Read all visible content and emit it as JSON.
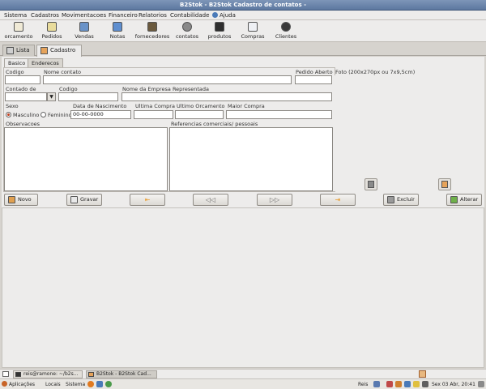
{
  "window": {
    "title": "B2Stok - B2Stok Cadastro de contatos -"
  },
  "menu": [
    "Sistema",
    "Cadastros",
    "Movimentacoes",
    "Financeiro",
    "Relatorios",
    "Contabilidade",
    "Ajuda"
  ],
  "toolbar": {
    "items": [
      {
        "label": "orcamento",
        "icon": "document-icon"
      },
      {
        "label": "Pedidos",
        "icon": "order-icon"
      },
      {
        "label": "Vendas",
        "icon": "sales-icon"
      },
      {
        "label": "Notas",
        "icon": "notes-icon"
      },
      {
        "label": "fornecedores",
        "icon": "truck-icon"
      },
      {
        "label": "contatos",
        "icon": "contacts-icon"
      },
      {
        "label": "produtos",
        "icon": "monitor-icon"
      },
      {
        "label": "Compras",
        "icon": "purchases-icon"
      },
      {
        "label": "Clientes",
        "icon": "clients-icon"
      }
    ]
  },
  "tabs": {
    "lista": "Lista",
    "cadastro": "Cadastro"
  },
  "subtabs": {
    "basico": "Basico",
    "enderecos": "Enderecos"
  },
  "form": {
    "codigo_label": "Codigo",
    "codigo_value": "",
    "nome_label": "Nome contato",
    "nome_value": "",
    "pedido_label": "Pedido Aberto",
    "pedido_value": "",
    "contado_label": "Contado de",
    "contado_value": "",
    "codigo2_label": "Codigo",
    "codigo2_value": "",
    "empresa_label": "Nome da Empresa Representada",
    "empresa_value": "",
    "sexo_label": "Sexo",
    "sexo_options": [
      "Masculino",
      "Feminino"
    ],
    "sexo_selected": "Masculino",
    "nasc_label": "Data de Nascimento",
    "nasc_value": "00-00-0000",
    "ult_compra_label": "Ultima Compra",
    "ult_compra_value": "",
    "ult_orc_label": "Ultimo Orcamento",
    "ult_orc_value": "",
    "maior_compra_label": "Maior Compra",
    "maior_compra_value": "",
    "obs_label": "Observacoes",
    "ref_label": "Referencias comerciais/ pessoais"
  },
  "photo": {
    "label": "Foto (200x270px ou 7x9,5cm)"
  },
  "actions": {
    "novo": "Novo",
    "gravar": "Gravar",
    "first": "",
    "prev": "◁◁",
    "next": "▷▷",
    "last": "",
    "excluir": "Excluir",
    "alterar": "Alterar"
  },
  "colors": {
    "accent": "#5d78a0",
    "titlebar": "#6b86ae",
    "orange_arrow": "#e89a2a"
  },
  "taskbar": {
    "items": [
      "reis@ramone: ~/b2s...",
      "B2Stok - B2Stok Cad..."
    ]
  },
  "panel": {
    "menus": [
      "Aplicações",
      "Locais",
      "Sistema"
    ],
    "user": "Reis",
    "clock": "Sex 03 Abr, 20:41"
  }
}
